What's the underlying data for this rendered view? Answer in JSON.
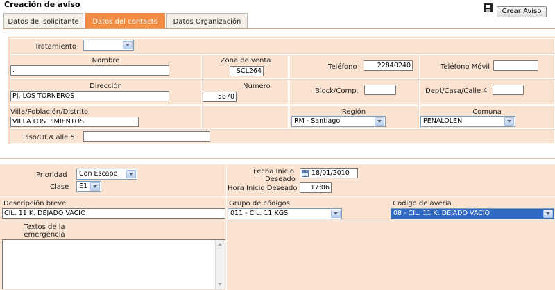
{
  "page": {
    "title": "Creación de aviso",
    "create_button": "Crear Aviso"
  },
  "tabs": [
    {
      "label": "Datos del solicitante",
      "active": false
    },
    {
      "label": "Datos del contacto",
      "active": true
    },
    {
      "label": "Datos Organización",
      "active": false
    }
  ],
  "contact": {
    "tratamiento": {
      "label": "Tratamiento",
      "value": ""
    },
    "nombre": {
      "label": "Nombre",
      "value": "."
    },
    "zona_venta": {
      "label": "Zona de venta",
      "value": "SCL264"
    },
    "telefono": {
      "label": "Teléfono",
      "value": "22840240"
    },
    "telefono_movil": {
      "label": "Teléfono Móvil",
      "value": ""
    },
    "direccion": {
      "label": "Dirección",
      "value": "PJ. LOS TORNEROS"
    },
    "numero": {
      "label": "Número",
      "value": "5870"
    },
    "block": {
      "label": "Block/Comp.",
      "value": ""
    },
    "dept": {
      "label": "Dept/Casa/Calle 4",
      "value": ""
    },
    "villa": {
      "label": "Villa/Población/Distrito",
      "value": "VILLA LOS PIMIENTOS"
    },
    "region": {
      "label": "Región",
      "value": "RM - Santiago"
    },
    "comuna": {
      "label": "Comuna",
      "value": "PEÑALOLEN"
    },
    "piso": {
      "label": "Piso/Of./Calle 5",
      "value": ""
    }
  },
  "notice": {
    "prioridad": {
      "label": "Prioridad",
      "value": "Con Escape"
    },
    "clase": {
      "label": "Clase",
      "value": "E1"
    },
    "fecha_inicio": {
      "label_1": "Fecha Inicio",
      "label_2": "Deseado",
      "value": "18/01/2010"
    },
    "hora_inicio": {
      "label": "Hora Inicio Deseado",
      "value": "17:06"
    },
    "descripcion": {
      "label": "Descripción breve",
      "value": "CIL. 11 K. DEJADO VACIO"
    },
    "grupo_codigos": {
      "label": "Grupo de códigos",
      "value": "011 - CIL. 11 KGS"
    },
    "codigo_averia": {
      "label": "Código de avería",
      "value": "08 - CIL. 11 K. DEJADO VACIO"
    },
    "textos": {
      "label_1": "Textos de la",
      "label_2": "emergencia",
      "value": ""
    }
  },
  "colors": {
    "tab_active": "#f08d43",
    "panel": "#f9d7c0",
    "cell": "#fbe3d2",
    "selected": "#316ac5"
  },
  "icons": [
    "save-icon",
    "calendar-icon",
    "chevron-down-icon"
  ]
}
